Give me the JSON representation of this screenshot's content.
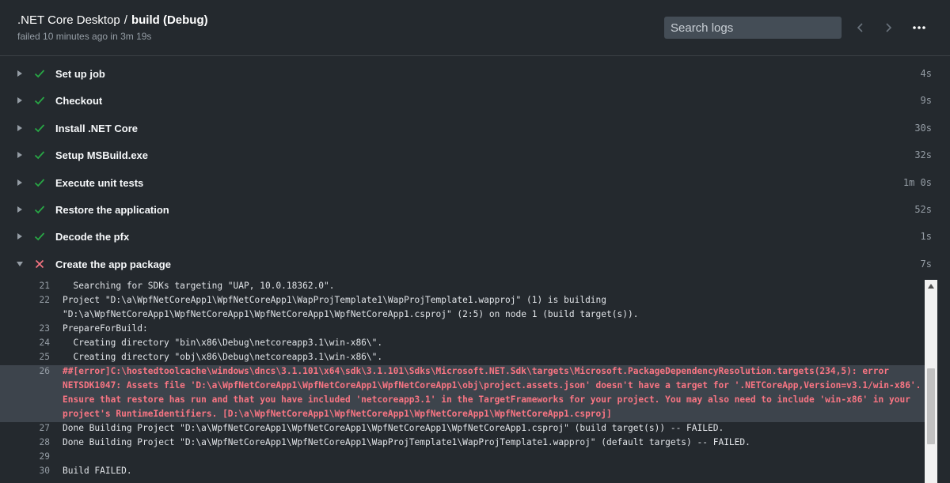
{
  "header": {
    "workflow": ".NET Core Desktop",
    "separator": "/",
    "job": "build (Debug)",
    "status_line": "failed 10 minutes ago in 3m 19s",
    "search_placeholder": "Search logs"
  },
  "colors": {
    "success": "#28a745",
    "failure": "#f97583",
    "background": "#24292e"
  },
  "steps": [
    {
      "name": "Set up job",
      "duration": "4s",
      "status": "success",
      "expanded": false
    },
    {
      "name": "Checkout",
      "duration": "9s",
      "status": "success",
      "expanded": false
    },
    {
      "name": "Install .NET Core",
      "duration": "30s",
      "status": "success",
      "expanded": false
    },
    {
      "name": "Setup MSBuild.exe",
      "duration": "32s",
      "status": "success",
      "expanded": false
    },
    {
      "name": "Execute unit tests",
      "duration": "1m 0s",
      "status": "success",
      "expanded": false
    },
    {
      "name": "Restore the application",
      "duration": "52s",
      "status": "success",
      "expanded": false
    },
    {
      "name": "Decode the pfx",
      "duration": "1s",
      "status": "success",
      "expanded": false
    },
    {
      "name": "Create the app package",
      "duration": "7s",
      "status": "failure",
      "expanded": true
    }
  ],
  "log": {
    "l21": {
      "num": "21",
      "text": "  Searching for SDKs targeting \"UAP, 10.0.18362.0\"."
    },
    "l22": {
      "num": "22",
      "text": "Project \"D:\\a\\WpfNetCoreApp1\\WpfNetCoreApp1\\WapProjTemplate1\\WapProjTemplate1.wapproj\" (1) is building"
    },
    "l22b": {
      "text": "\"D:\\a\\WpfNetCoreApp1\\WpfNetCoreApp1\\WpfNetCoreApp1\\WpfNetCoreApp1.csproj\" (2:5) on node 1 (build target(s))."
    },
    "l23": {
      "num": "23",
      "text": "PrepareForBuild:"
    },
    "l24": {
      "num": "24",
      "text": "  Creating directory \"bin\\x86\\Debug\\netcoreapp3.1\\win-x86\\\"."
    },
    "l25": {
      "num": "25",
      "text": "  Creating directory \"obj\\x86\\Debug\\netcoreapp3.1\\win-x86\\\"."
    },
    "l26": {
      "num": "26",
      "text1": "##[error]C:\\hostedtoolcache\\windows\\dncs\\3.1.101\\x64\\sdk\\3.1.101\\Sdks\\Microsoft.NET.Sdk\\targets\\Microsoft.PackageDependencyResolution.targets(234,5): error",
      "text2": "NETSDK1047: Assets file 'D:\\a\\WpfNetCoreApp1\\WpfNetCoreApp1\\WpfNetCoreApp1\\obj\\project.assets.json' doesn't have a target for '.NETCoreApp,Version=v3.1/win-x86'.",
      "text3": "Ensure that restore has run and that you have included 'netcoreapp3.1' in the TargetFrameworks for your project. You may also need to include 'win-x86' in your",
      "text4": "project's RuntimeIdentifiers. [D:\\a\\WpfNetCoreApp1\\WpfNetCoreApp1\\WpfNetCoreApp1\\WpfNetCoreApp1.csproj]"
    },
    "l27": {
      "num": "27",
      "text": "Done Building Project \"D:\\a\\WpfNetCoreApp1\\WpfNetCoreApp1\\WpfNetCoreApp1\\WpfNetCoreApp1.csproj\" (build target(s)) -- FAILED."
    },
    "l28": {
      "num": "28",
      "text": "Done Building Project \"D:\\a\\WpfNetCoreApp1\\WpfNetCoreApp1\\WapProjTemplate1\\WapProjTemplate1.wapproj\" (default targets) -- FAILED."
    },
    "l29": {
      "num": "29",
      "text": ""
    },
    "l30": {
      "num": "30",
      "text": "Build FAILED."
    }
  }
}
